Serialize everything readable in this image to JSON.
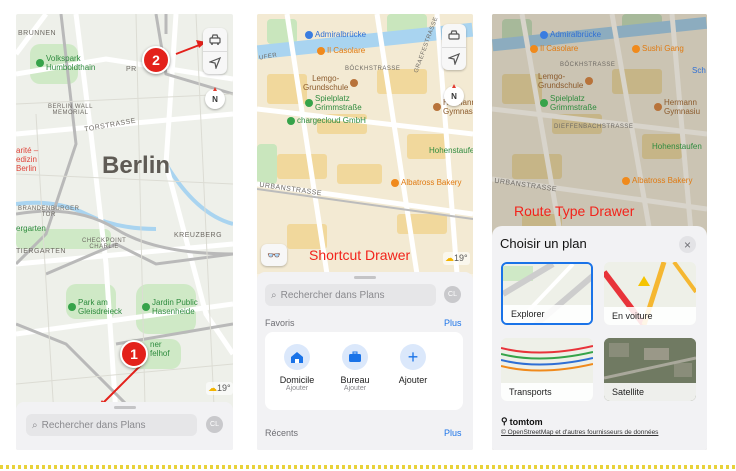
{
  "panel1": {
    "labels": {
      "brunnen": "BRUNNEN",
      "pr": "PR",
      "volkspark": "Volkspark\nHumboldthain",
      "berlin_wall": "BERLIN WALL\nMEMORIAL",
      "torstrasse": "TORSTRASSE",
      "charite": "arité –\nedizin\nBerlin",
      "city": "Berlin",
      "brandenburger": "BRANDENBURGER\nTOR",
      "ergarten": "ergarten",
      "tiergarten": "TIERGARTEN",
      "checkpoint": "CHECKPOINT\nCHARLIE",
      "kreuzberg": "KREUZBERG",
      "park_gleis": "Park am\nGleisdreieck",
      "jardin": "Jardin Public\nHasenheide",
      "tempelhof": "ner\nfelhof"
    },
    "weather": "19°",
    "search_placeholder": "Rechercher dans Plans",
    "avatar": "CL",
    "compass": "N",
    "badge1": "1",
    "badge2": "2"
  },
  "panel2": {
    "labels": {
      "admiral": "Admiralbrücke",
      "casolare": "Il Casolare",
      "bockh": "BÖCKHSTRASSE",
      "graefe": "GRAEFESTRASSE",
      "ufer": "UFER",
      "lemgo": "Lemgo-\nGrundschule",
      "spielplatz": "Spielplatz\nGrimmstraße",
      "charge": "chargecloud GmbH",
      "hohenstaufen": "Hohenstaufen",
      "albatross": "Albatross Bakery",
      "urbanstrasse": "URBANSTRASSE",
      "hermann": "Hermann\nGymnasiu"
    },
    "annotation": "Shortcut Drawer",
    "weather": "19°",
    "search_placeholder": "Rechercher dans Plans",
    "avatar": "CL",
    "favoris": "Favoris",
    "plus": "Plus",
    "favorites": [
      {
        "name": "Domicile",
        "sub": "Ajouter"
      },
      {
        "name": "Bureau",
        "sub": "Ajouter"
      },
      {
        "name": "Ajouter",
        "sub": ""
      }
    ],
    "recents": "Récents",
    "recents_plus": "Plus",
    "compass": "N"
  },
  "panel3": {
    "labels": {
      "admiral": "Admiralbrücke",
      "casolare": "Il Casolare",
      "sushi": "Sushi Gang",
      "bockh": "BÖCKHSTRASSE",
      "lemgo": "Lemgo-\nGrundschule",
      "spielplatz": "Spielplatz\nGrimmstraße",
      "hermann": "Hermann\nGymnasiu",
      "dieffenbach": "DIEFFENBACHSTRASSE",
      "hohenstaufen": "Hohenstaufen",
      "albatross": "Albatross Bakery",
      "urbanstrasse": "URBANSTRASSE",
      "sch": "Sch"
    },
    "annotation": "Route Type Drawer",
    "title": "Choisir un plan",
    "close": "×",
    "tiles": [
      {
        "label": "Explorer",
        "selected": true
      },
      {
        "label": "En voiture",
        "selected": false
      },
      {
        "label": "Transports",
        "selected": false
      },
      {
        "label": "Satellite",
        "selected": false
      }
    ],
    "provider": "tomtom",
    "attribution": "© OpenStreetMap et d'autres fournisseurs de données"
  },
  "colors": {
    "annotation": "#f2231b",
    "accent": "#1a73e8",
    "badge": "#e3211b"
  }
}
